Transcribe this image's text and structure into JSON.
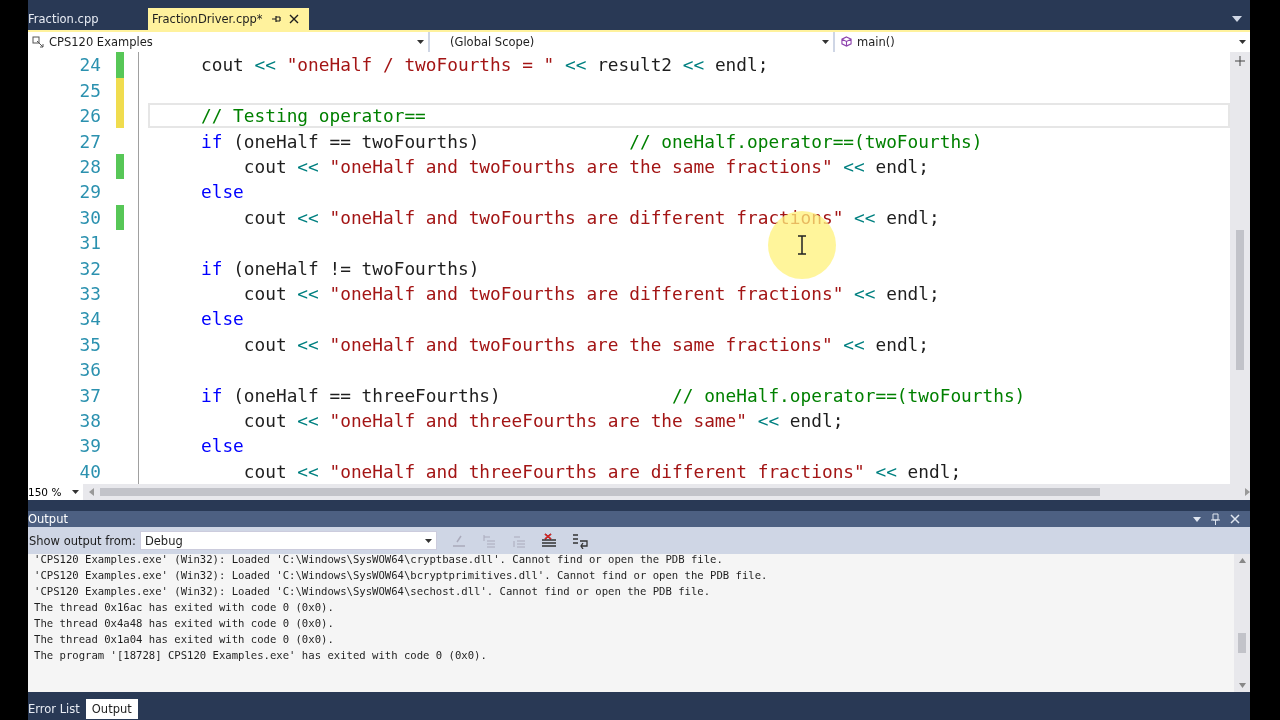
{
  "editor_tabs": [
    {
      "label": "Fraction.cpp",
      "selected": false
    },
    {
      "label": "FractionDriver.cpp*",
      "selected": true
    }
  ],
  "navigation_bar": {
    "project": "CPS120 Examples",
    "scope": "(Global Scope)",
    "member": "main()"
  },
  "code_lines": [
    {
      "number": "24",
      "color": "#57c757",
      "current": false,
      "tokens": [
        {
          "kind": "plain",
          "text": "cout "
        },
        {
          "kind": "operator",
          "text": "<< "
        },
        {
          "kind": "string",
          "text": "\"oneHalf / twoFourths = \" "
        },
        {
          "kind": "operator",
          "text": "<<"
        },
        {
          "kind": "plain",
          "text": " result2 "
        },
        {
          "kind": "operator",
          "text": "<<"
        },
        {
          "kind": "plain",
          "text": " endl;"
        }
      ]
    },
    {
      "number": "25",
      "color": "#f0dc4e",
      "current": false
    },
    {
      "number": "26",
      "color": "#f0dc4e",
      "current": true,
      "tokens": [
        {
          "kind": "comment",
          "text": "// Testing operator=="
        }
      ]
    },
    {
      "number": "27",
      "current": false,
      "tokens": [
        {
          "kind": "keyword",
          "text": "if"
        },
        {
          "kind": "plain",
          "text": " (oneHalf == twoFourths)              "
        },
        {
          "kind": "comment",
          "text": "// oneHalf.operator==(twoFourths)"
        }
      ]
    },
    {
      "number": "28",
      "color": "#57c757",
      "current": false,
      "tokens": [
        {
          "kind": "plain",
          "text": "    cout "
        },
        {
          "kind": "operator",
          "text": "<< "
        },
        {
          "kind": "string",
          "text": "\"oneHalf and twoFourths are the same fractions\" "
        },
        {
          "kind": "operator",
          "text": "<<"
        },
        {
          "kind": "plain",
          "text": " endl;"
        }
      ]
    },
    {
      "number": "29",
      "current": false,
      "tokens": [
        {
          "kind": "keyword",
          "text": "else"
        }
      ]
    },
    {
      "number": "30",
      "color": "#57c757",
      "current": false,
      "tokens": [
        {
          "kind": "plain",
          "text": "    cout "
        },
        {
          "kind": "operator",
          "text": "<< "
        },
        {
          "kind": "string",
          "text": "\"oneHalf and twoFourths are different fractions\" "
        },
        {
          "kind": "operator",
          "text": "<<"
        },
        {
          "kind": "plain",
          "text": " endl;"
        }
      ]
    },
    {
      "number": "31",
      "current": false
    },
    {
      "number": "32",
      "current": false,
      "tokens": [
        {
          "kind": "keyword",
          "text": "if"
        },
        {
          "kind": "plain",
          "text": " (oneHalf != twoFourths)"
        }
      ]
    },
    {
      "number": "33",
      "current": false,
      "tokens": [
        {
          "kind": "plain",
          "text": "    cout "
        },
        {
          "kind": "operator",
          "text": "<< "
        },
        {
          "kind": "string",
          "text": "\"oneHalf and twoFourths are different fractions\" "
        },
        {
          "kind": "operator",
          "text": "<<"
        },
        {
          "kind": "plain",
          "text": " endl;"
        }
      ]
    },
    {
      "number": "34",
      "current": false,
      "tokens": [
        {
          "kind": "keyword",
          "text": "else"
        }
      ]
    },
    {
      "number": "35",
      "current": false,
      "tokens": [
        {
          "kind": "plain",
          "text": "    cout "
        },
        {
          "kind": "operator",
          "text": "<< "
        },
        {
          "kind": "string",
          "text": "\"oneHalf and twoFourths are the same fractions\" "
        },
        {
          "kind": "operator",
          "text": "<<"
        },
        {
          "kind": "plain",
          "text": " endl;"
        }
      ]
    },
    {
      "number": "36",
      "current": false
    },
    {
      "number": "37",
      "current": false,
      "tokens": [
        {
          "kind": "keyword",
          "text": "if"
        },
        {
          "kind": "plain",
          "text": " (oneHalf == threeFourths)                "
        },
        {
          "kind": "comment",
          "text": "// oneHalf.operator==(twoFourths)"
        }
      ]
    },
    {
      "number": "38",
      "current": false,
      "tokens": [
        {
          "kind": "plain",
          "text": "    cout "
        },
        {
          "kind": "operator",
          "text": "<< "
        },
        {
          "kind": "string",
          "text": "\"oneHalf and threeFourths are the same\" "
        },
        {
          "kind": "operator",
          "text": "<<"
        },
        {
          "kind": "plain",
          "text": " endl;"
        }
      ]
    },
    {
      "number": "39",
      "current": false,
      "tokens": [
        {
          "kind": "keyword",
          "text": "else"
        }
      ]
    },
    {
      "number": "40",
      "current": false,
      "tokens": [
        {
          "kind": "plain",
          "text": "    cout "
        },
        {
          "kind": "operator",
          "text": "<< "
        },
        {
          "kind": "string",
          "text": "\"oneHalf and threeFourths are different fractions\" "
        },
        {
          "kind": "operator",
          "text": "<<"
        },
        {
          "kind": "plain",
          "text": " endl;"
        }
      ]
    }
  ],
  "zoom": "150 %",
  "output_panel": {
    "title": "Output",
    "source_label": "Show output from:",
    "source": "Debug",
    "lines": [
      "'CPS120 Examples.exe' (Win32): Loaded 'C:\\Windows\\SysWOW64\\cryptbase.dll'. Cannot find or open the PDB file.",
      "'CPS120 Examples.exe' (Win32): Loaded 'C:\\Windows\\SysWOW64\\bcryptprimitives.dll'. Cannot find or open the PDB file.",
      "'CPS120 Examples.exe' (Win32): Loaded 'C:\\Windows\\SysWOW64\\sechost.dll'. Cannot find or open the PDB file.",
      "The thread 0x16ac has exited with code 0 (0x0).",
      "The thread 0x4a48 has exited with code 0 (0x0).",
      "The thread 0x1a04 has exited with code 0 (0x0).",
      "The program '[18728] CPS120 Examples.exe' has exited with code 0 (0x0)."
    ]
  },
  "bottom_tabs": [
    {
      "label": "Error List",
      "selected": false
    },
    {
      "label": "Output",
      "selected": true
    }
  ]
}
